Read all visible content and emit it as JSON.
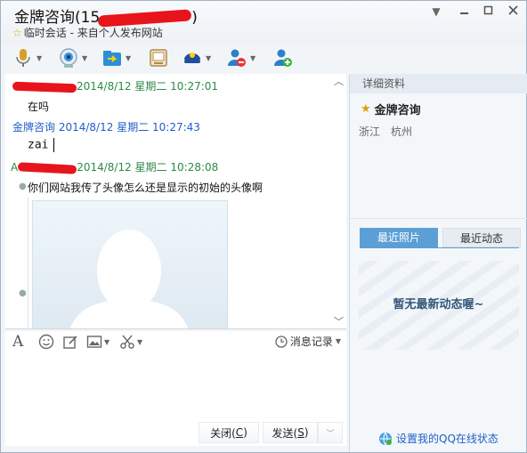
{
  "window": {
    "title": "金牌咨询(15",
    "title_suffix": ")",
    "subtitle": "临时会话 - 来自个人发布网站"
  },
  "toolbar": {
    "icons": [
      "microphone-icon",
      "video-camera-icon",
      "file-transfer-icon",
      "remote-desktop-icon",
      "app-icon",
      "block-user-icon",
      "add-friend-icon"
    ]
  },
  "chat": {
    "messages": [
      {
        "header_time": "2014/8/12 星期二 10:27:01",
        "text": "在吗"
      },
      {
        "sender": "金牌咨询",
        "header_time": "2014/8/12 星期二 10:27:43",
        "text": "zai"
      },
      {
        "sender_initial": "A",
        "header_time": "2014/8/12 星期二 10:28:08",
        "text": "你们网站我传了头像怎么还是显示的初始的头像啊"
      }
    ]
  },
  "input_toolbar": {
    "history_label": "消息记录"
  },
  "buttons": {
    "close_label": "关闭(",
    "close_key": "C",
    "close_tail": ")",
    "send_label": "发送(",
    "send_key": "S",
    "send_tail": ")"
  },
  "profile": {
    "header": "详细资料",
    "name": "金牌咨询",
    "province": "浙江",
    "city": "杭州"
  },
  "tabs": {
    "photos": "最近照片",
    "activity": "最近动态"
  },
  "empty_state": "暂无最新动态喔~",
  "status_link": "设置我的QQ在线状态",
  "colors": {
    "accent_blue": "#5c9fd6",
    "timestamp_green": "#2b8b45",
    "sender_blue": "#1f5fc9",
    "redaction_red": "#e8141c"
  }
}
